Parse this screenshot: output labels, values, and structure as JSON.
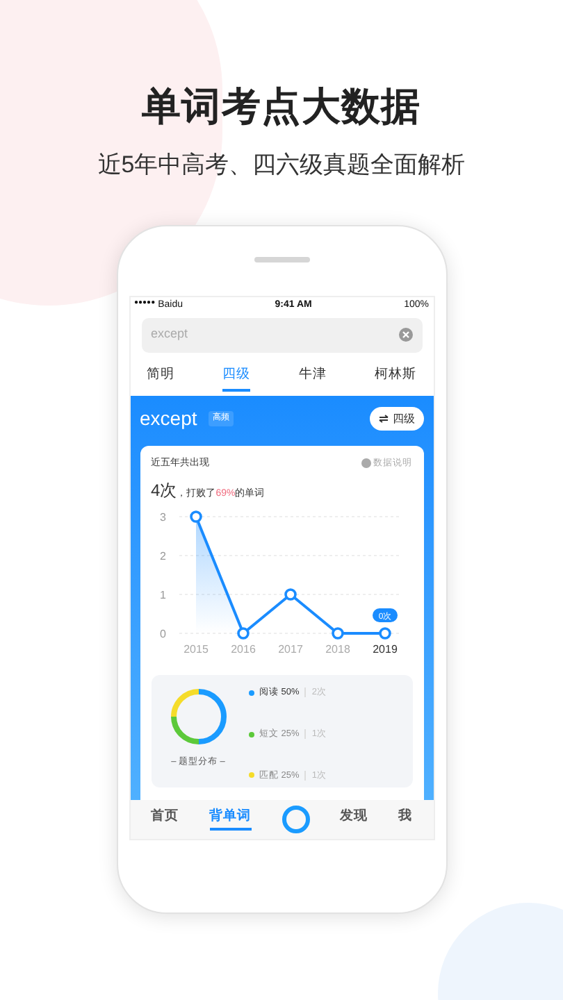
{
  "headline": "单词考点大数据",
  "subheadline": "近5年中高考、四六级真题全面解析",
  "status_bar": {
    "signal": "●●●●●",
    "carrier": "Baidu",
    "time": "9:41 AM",
    "battery": "100%"
  },
  "search": {
    "value": "except"
  },
  "tabs": [
    {
      "label": "简明",
      "selected": false
    },
    {
      "label": "四级",
      "selected": true
    },
    {
      "label": "牛津",
      "selected": false
    },
    {
      "label": "柯林斯",
      "selected": false
    }
  ],
  "word": {
    "text": "except",
    "tag": "高频",
    "switch_label": "四级"
  },
  "stats": {
    "title": "近五年共出现",
    "help": "数据说明",
    "count": "4次",
    "summary_prefix": "，打败了",
    "percent": "69%",
    "summary_suffix": "的单词",
    "chart_data": {
      "type": "line",
      "categories": [
        "2015",
        "2016",
        "2017",
        "2018",
        "2019"
      ],
      "series": [
        {
          "color": "#1a8cff",
          "marker": "circle",
          "values": [
            3,
            0,
            1,
            0,
            0
          ]
        }
      ],
      "ylim": [
        0,
        3
      ],
      "yticks": [
        0,
        1,
        2,
        3
      ]
    },
    "tooltip": "0次"
  },
  "distribution": {
    "caption": "– 题型分布 –",
    "items": [
      {
        "label": "阅读 50%",
        "count": "2次",
        "color": "#1a9bff"
      },
      {
        "label": "短文 25%",
        "count": "1次",
        "color": "#5cc93a"
      },
      {
        "label": "匹配 25%",
        "count": "1次",
        "color": "#f5dc2a"
      }
    ]
  },
  "bottom_nav": [
    {
      "label": "首页",
      "selected": false,
      "kind": "text"
    },
    {
      "label": "背单词",
      "selected": true,
      "kind": "text"
    },
    {
      "kind": "center"
    },
    {
      "label": "发现",
      "selected": false,
      "kind": "text"
    },
    {
      "label": "我",
      "selected": false,
      "kind": "text"
    }
  ]
}
